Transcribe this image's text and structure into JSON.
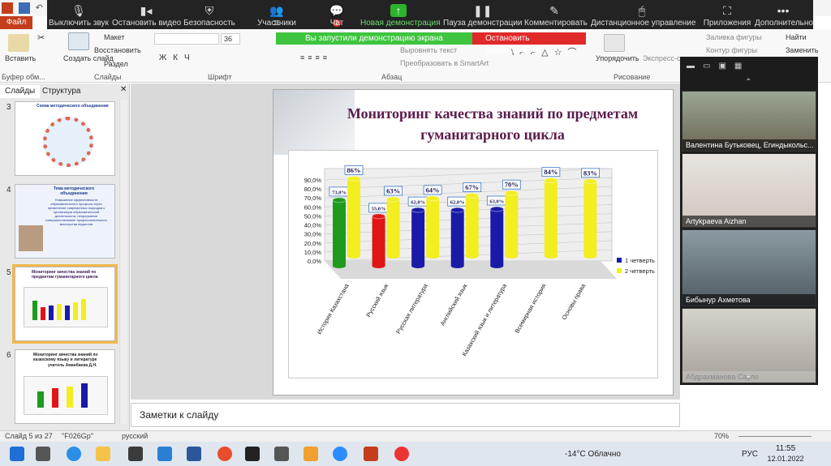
{
  "zoom_toolbar": {
    "mute": "Выключить звук",
    "video": "Остановить видео",
    "security": "Безопасность",
    "participants": "Участники",
    "participants_count": "11",
    "chat": "Чат",
    "chat_badge": "1",
    "new_share": "Новая демонстрация",
    "pause_share": "Пауза демонстрации",
    "annotate": "Комментировать",
    "remote_control": "Дистанционное управление",
    "apps": "Приложения",
    "more": "Дополнительно",
    "share_banner": "Вы запустили демонстрацию экрана",
    "stop_share": "Остановить демонстрацию"
  },
  "ribbon": {
    "file_tab": "Файл",
    "paste": "Вставить",
    "clipboard": "Буфер обм...",
    "new_slide": "Создать слайд",
    "layout": "Макет",
    "reset": "Восстановить",
    "section": "Раздел",
    "slides_group": "Слайды",
    "font_size": "36",
    "font_group": "Шрифт",
    "paragraph_group": "Абзац",
    "align_text": "Выровнять текст",
    "smartart": "Преобразовать в SmartArt",
    "text_dir": "Направление текста",
    "arrange": "Упорядочить",
    "quick_styles": "Экспресс-ст",
    "drawing_group": "Рисование",
    "shape_fill": "Заливка фигуры",
    "shape_outline": "Контур фигуры",
    "find": "Найти",
    "replace": "Заменить"
  },
  "panes": {
    "slides_tab": "Слайды",
    "outline_tab": "Структура"
  },
  "thumbnails": [
    {
      "num": "3",
      "title": "Схема методического объединения"
    },
    {
      "num": "4",
      "title": "Тема методического объединения",
      "body": "Повышение эффективности образовательного процесса через применение современных подходов к организации образовательной деятельности, непрерывное совершенствование профессионального мастерства педагогов"
    },
    {
      "num": "5",
      "title": "Мониторинг качества знаний по предметам гуманитарного цикла"
    },
    {
      "num": "6",
      "title": "Мониторинг качества знаний по казахскому языку и литературе",
      "sub": "учитель Аманбаева Д.Н."
    }
  ],
  "slide": {
    "title_line1": "Мониторинг качества знаний по предметам",
    "title_line2": "гуманитарного цикла"
  },
  "chart_data": {
    "type": "bar",
    "categories": [
      "История Казахстана",
      "Русский язык",
      "Русская литература",
      "Английский язык",
      "Казахский язык и литература",
      "Всемирная история",
      "Основы права"
    ],
    "series": [
      {
        "name": "1 четверть",
        "values": [
          73.0,
          55.0,
          62.0,
          62.0,
          63.0,
          null,
          null
        ],
        "labels": [
          "73,0%",
          "55,0%",
          "62,0%",
          "62,0%",
          "63,0%",
          "",
          ""
        ]
      },
      {
        "name": "2 четверть",
        "values": [
          86,
          63,
          64,
          67,
          70,
          84,
          83
        ],
        "labels": [
          "86%",
          "63%",
          "64%",
          "67%",
          "70%",
          "84%",
          "83%"
        ]
      }
    ],
    "yticks": [
      "0,0%",
      "10,0%",
      "20,0%",
      "30,0%",
      "40,0%",
      "50,0%",
      "60,0%",
      "70,0%",
      "80,0%",
      "90,0%"
    ],
    "ylim": [
      0,
      90
    ],
    "bar_colors": {
      "history": "#1f9a1f",
      "russian": "#e01515",
      "blue": "#1a1aa8",
      "yellow": "#f2ee20"
    },
    "legend_position": "right",
    "grid": true
  },
  "notes": "Заметки к слайду",
  "video_tiles": [
    {
      "name": "Валентина Бутьковец, Егиндыкольс..."
    },
    {
      "name": "Artykpaeva Aizhan"
    },
    {
      "name": "Бибынур Ахметова"
    },
    {
      "name": "Абдрахманова Сауле"
    }
  ],
  "status": {
    "slide": "Слайд 5 из 27",
    "theme": "\"F026Gp\"",
    "lang": "русский",
    "zoom": "70%"
  },
  "taskbar": {
    "weather": "-14°C  Облачно",
    "lang": "РУС",
    "time": "11:55",
    "date": "12.01.2022"
  }
}
